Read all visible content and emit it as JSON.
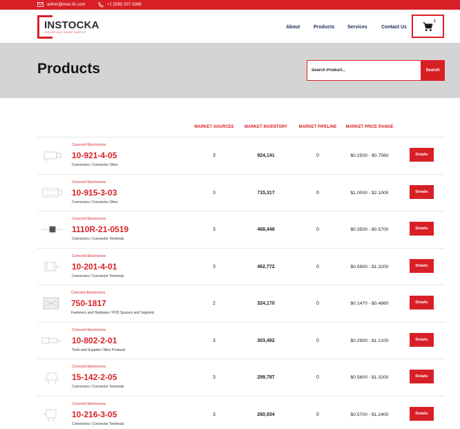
{
  "topbar": {
    "email": "admin@mwc-llc.com",
    "phone": "+1 (508) 337-3388"
  },
  "brand": {
    "name": "INSTOCKA",
    "tagline": "SOURCING MADE SIMPLE",
    "accent": "#d81f26",
    "nav_color": "#1b2a55"
  },
  "nav": {
    "items": [
      "About",
      "Products",
      "Services",
      "Contact Us"
    ]
  },
  "cart": {
    "count": "1"
  },
  "banner": {
    "title": "Products"
  },
  "search": {
    "placeholder": "Search Product...",
    "button_label": "Search"
  },
  "table": {
    "columns": [
      "MARKET SOURCES",
      "MARKET INVENTORY",
      "MARKET PIPELINE",
      "MARKET PRICE RANGE"
    ],
    "details_label": "Details",
    "rows": [
      {
        "manufacturer": "Concord Electronics",
        "part": "10-921-4-05",
        "category": "Connectors / Connector Other",
        "sources": "3",
        "inventory": "924,141",
        "pipeline": "0",
        "price": "$0.2500 - $0.7560"
      },
      {
        "manufacturer": "Concord Electronics",
        "part": "10-915-3-03",
        "category": "Connectors / Connector Other",
        "sources": "3",
        "inventory": "715,317",
        "pipeline": "0",
        "price": "$1.0000 - $2.1000"
      },
      {
        "manufacturer": "Concord Electronics",
        "part": "1110R-21-0519",
        "category": "Connectors / Connector Terminals",
        "sources": "3",
        "inventory": "468,448",
        "pipeline": "0",
        "price": "$0.3500 - $0.5700"
      },
      {
        "manufacturer": "Concord Electronics",
        "part": "10-201-4-01",
        "category": "Connectors / Connector Terminals",
        "sources": "3",
        "inventory": "462,772",
        "pipeline": "0",
        "price": "$0.5900 - $1.3200"
      },
      {
        "manufacturer": "Concord Electronics",
        "part": "750-1817",
        "category": "Fasteners and Hardware / PCB Spacers and Supports",
        "sources": "2",
        "inventory": "324,170",
        "pipeline": "0",
        "price": "$0.1470 - $0.4860"
      },
      {
        "manufacturer": "Concord Electronics",
        "part": "10-802-2-01",
        "category": "Tools and Supplies / Misc Products",
        "sources": "3",
        "inventory": "303,482",
        "pipeline": "0",
        "price": "$0.2900 - $1.2100"
      },
      {
        "manufacturer": "Concord Electronics",
        "part": "15-142-2-05",
        "category": "Connectors / Connector Terminals",
        "sources": "3",
        "inventory": "299,787",
        "pipeline": "0",
        "price": "$0.5600 - $1.3200"
      },
      {
        "manufacturer": "Concord Electronics",
        "part": "10-216-3-05",
        "category": "Connectors / Connector Terminals",
        "sources": "3",
        "inventory": "260,934",
        "pipeline": "0",
        "price": "$0.5700 - $1.2400"
      }
    ]
  }
}
